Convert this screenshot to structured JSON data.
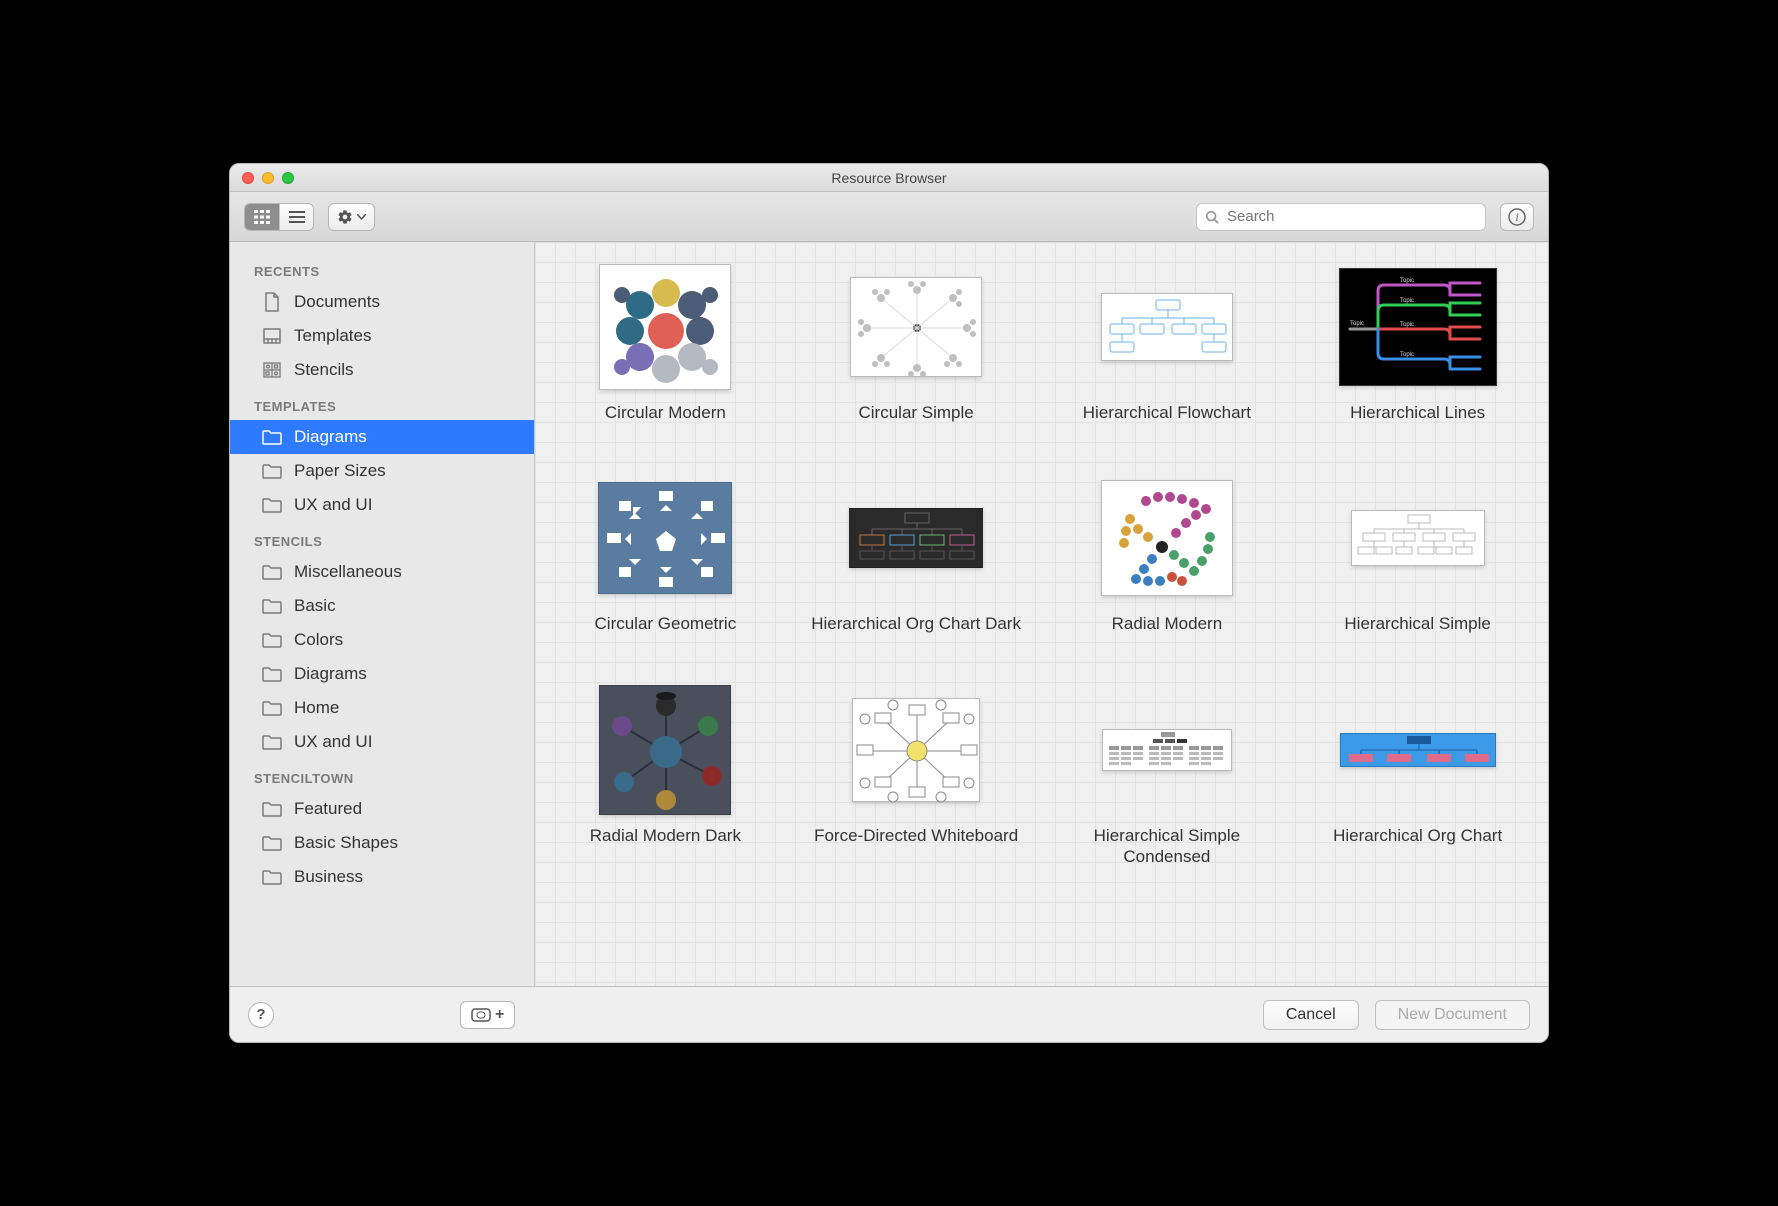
{
  "window": {
    "title": "Resource Browser"
  },
  "toolbar": {
    "search_placeholder": "Search"
  },
  "sidebar": {
    "sections": {
      "recents": {
        "header": "RECENTS",
        "items": [
          {
            "label": "Documents"
          },
          {
            "label": "Templates"
          },
          {
            "label": "Stencils"
          }
        ]
      },
      "templates": {
        "header": "TEMPLATES",
        "items": [
          {
            "label": "Diagrams",
            "selected": true
          },
          {
            "label": "Paper Sizes"
          },
          {
            "label": "UX and UI"
          }
        ]
      },
      "stencils": {
        "header": "STENCILS",
        "items": [
          {
            "label": "Miscellaneous"
          },
          {
            "label": "Basic"
          },
          {
            "label": "Colors"
          },
          {
            "label": "Diagrams"
          },
          {
            "label": "Home"
          },
          {
            "label": "UX and UI"
          }
        ]
      },
      "stenciltown": {
        "header": "STENCILTOWN",
        "items": [
          {
            "label": "Featured"
          },
          {
            "label": "Basic Shapes"
          },
          {
            "label": "Business"
          }
        ]
      }
    }
  },
  "grid": {
    "items": [
      {
        "label": "Circular Modern"
      },
      {
        "label": "Circular Simple"
      },
      {
        "label": "Hierarchical Flowchart"
      },
      {
        "label": "Hierarchical Lines"
      },
      {
        "label": "Circular Geometric"
      },
      {
        "label": "Hierarchical Org Chart Dark"
      },
      {
        "label": "Radial Modern"
      },
      {
        "label": "Hierarchical Simple"
      },
      {
        "label": "Radial Modern Dark"
      },
      {
        "label": "Force-Directed Whiteboard"
      },
      {
        "label": "Hierarchical Simple Condensed"
      },
      {
        "label": "Hierarchical Org Chart"
      }
    ]
  },
  "footer": {
    "cancel_label": "Cancel",
    "new_document_label": "New Document"
  }
}
